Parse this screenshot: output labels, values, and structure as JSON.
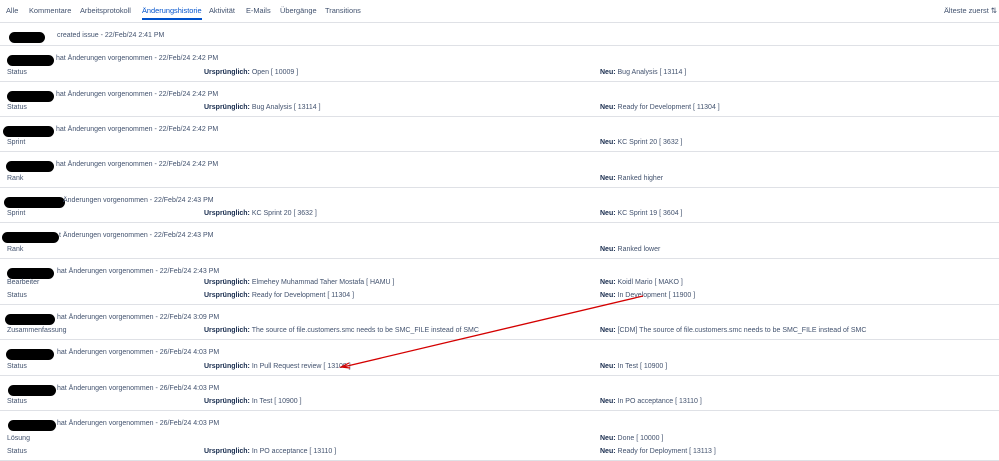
{
  "tabs": [
    "Alle",
    "Kommentare",
    "Arbeitsprotokoll",
    "Änderungshistorie",
    "Aktivität",
    "E-Mails",
    "Übergänge",
    "Transitions"
  ],
  "active_tab": "Änderungshistorie",
  "sort_label": "Älteste zuerst ⇅",
  "labels": {
    "original": "Ursprünglich:",
    "new": "Neu:"
  },
  "entries": [
    {
      "headline": "created issue - 22/Feb/24 2:41 PM",
      "changes": []
    },
    {
      "headline": "hat Änderungen vorgenommen - 22/Feb/24 2:42 PM",
      "changes": [
        {
          "field": "Status",
          "original": "Open [ 10009 ]",
          "new": "Bug Analysis [ 13114 ]"
        }
      ]
    },
    {
      "headline": "hat Änderungen vorgenommen - 22/Feb/24 2:42 PM",
      "changes": [
        {
          "field": "Status",
          "original": "Bug Analysis [ 13114 ]",
          "new": "Ready for Development [ 11304 ]"
        }
      ]
    },
    {
      "headline": "hat Änderungen vorgenommen - 22/Feb/24 2:42 PM",
      "changes": [
        {
          "field": "Sprint",
          "original": "",
          "new": "KC Sprint 20 [ 3632 ]"
        }
      ]
    },
    {
      "headline": "hat Änderungen vorgenommen - 22/Feb/24 2:42 PM",
      "changes": [
        {
          "field": "Rank",
          "original": "",
          "new": "Ranked higher"
        }
      ]
    },
    {
      "headline": "Änderungen vorgenommen - 22/Feb/24 2:43 PM",
      "changes": [
        {
          "field": "Sprint",
          "original": "KC Sprint 20 [ 3632 ]",
          "new": "KC Sprint 19 [ 3604 ]"
        }
      ]
    },
    {
      "headline": "t Änderungen vorgenommen - 22/Feb/24 2:43 PM",
      "changes": [
        {
          "field": "Rank",
          "original": "",
          "new": "Ranked lower"
        }
      ]
    },
    {
      "headline": "hat Änderungen vorgenommen - 22/Feb/24 2:43 PM",
      "changes": [
        {
          "field": "Bearbeiter",
          "original": "Elmehey Muhammad Taher Mostafa [ HAMU ]",
          "new": "Koidl Mario [ MAKO ]"
        },
        {
          "field": "Status",
          "original": "Ready for Development [ 11304 ]",
          "new": "In Development [ 11900 ]"
        }
      ]
    },
    {
      "headline": "hat Änderungen vorgenommen - 22/Feb/24 3:09 PM",
      "changes": [
        {
          "field": "Zusammenfassung",
          "original": "The source of file.customers.smc needs to be SMC_FILE instead of SMC",
          "new": "[CDM] The source of file.customers.smc needs to be SMC_FILE instead of SMC"
        }
      ]
    },
    {
      "headline": "hat Änderungen vorgenommen - 26/Feb/24 4:03 PM",
      "changes": [
        {
          "field": "Status",
          "original": "In Pull Request review [ 13109 ]",
          "new": "In Test [ 10900 ]"
        }
      ]
    },
    {
      "headline": "hat Änderungen vorgenommen - 26/Feb/24 4:03 PM",
      "changes": [
        {
          "field": "Status",
          "original": "In Test [ 10900 ]",
          "new": "In PO acceptance [ 13110 ]"
        }
      ]
    },
    {
      "headline": "hat Änderungen vorgenommen - 26/Feb/24 4:03 PM",
      "changes": [
        {
          "field": "Lösung",
          "original": "",
          "new": "Done [ 10000 ]"
        },
        {
          "field": "Status",
          "original": "In PO acceptance [ 13110 ]",
          "new": "Ready for Deployment [ 13113 ]"
        }
      ]
    }
  ]
}
